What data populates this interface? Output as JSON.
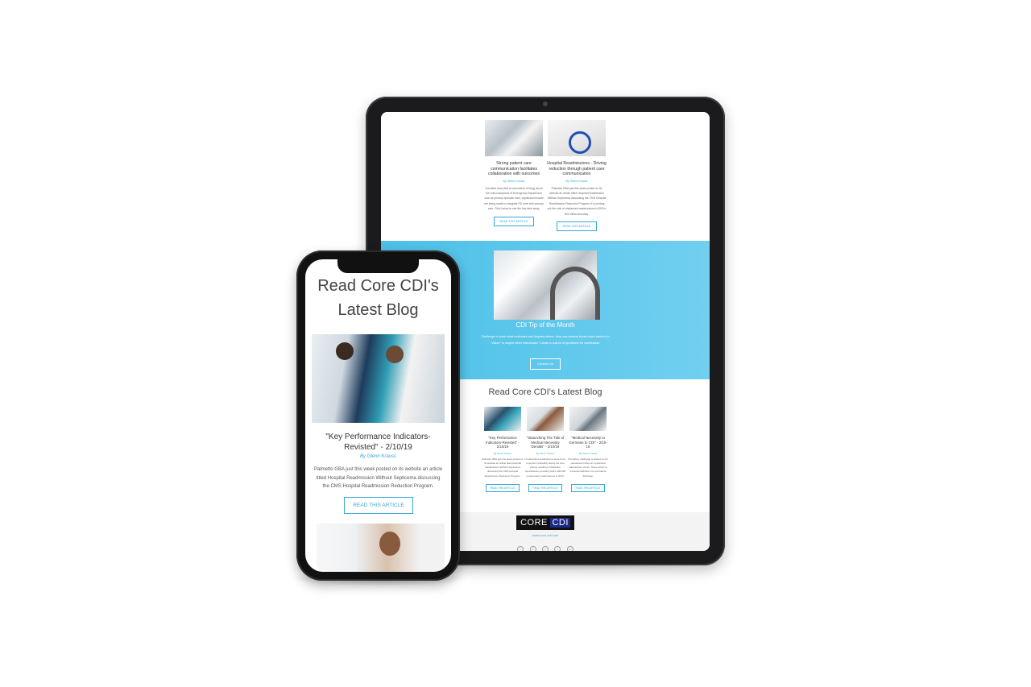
{
  "tablet": {
    "top_articles": [
      {
        "title": "Strong patient care communication facilitates collaboration with outcomes",
        "byline": "By Glenn Krauss",
        "body": "Excellent read (link at conclusion of blog) about the misconceptions of Emergency Department care as primary episodic care, significant inroads are being made to integrate ED care with primary care. Click below to see the key take away.",
        "button": "READ THIS ARTICLE",
        "image_icon": "hospital-image"
      },
      {
        "title": "Hospital Readmissions - Driving reduction through patient care communication",
        "byline": "By Glenn Krauss",
        "body": "Palmetto GBA just this week posted on its website an article titled Hospital Readmission Without Septicema discussing the CMS Hospital Readmission Reduction Program. It's pointing out the cost of unplanned readmissions is $15 to $20 billion annually.",
        "button": "READ THIS ARTICLE",
        "image_icon": "stethoscope-image"
      }
    ],
    "tip": {
      "title": "CDI Tip of the Month",
      "text": "Challenge to learn what motivates and inspires others. How can leaders break down barriers in \"Vision\" to inspire other individuals? Create a culture of questions for clarification.",
      "button": "Contact Us"
    },
    "blog": {
      "title": "Read Core CDI's Latest Blog",
      "articles": [
        {
          "title": "\"Key Performance Indicators-Revisted\" - 2/10/19",
          "byline": "By Glenn Krauss",
          "body": "Palmetto GBA just this week posted on its website an article titled Hospital Readmission Without Septicema discussing the CMS Hospital Readmission Reduction Program.",
          "button": "READ THIS ARTICLE"
        },
        {
          "title": "\"Staunching The Tide of Medical Necessity Denials\" - 2/10/19",
          "byline": "By Glenn Krauss",
          "body": "Unwarranted readmissions were hit by a percent noticeably during the time period, resulting in Medicare beneficiaries providing total's 100,000 unnecessary readmissions in 2013.",
          "button": "READ THIS ARTICLE"
        },
        {
          "title": "\"Medical Necessity to Germane to CDI\" - 2/10-19",
          "byline": "By Glenn Krauss",
          "body": "Premature discharge is always a root cause/event when an unplanned readmission occurs. There exists no universal definition of a premature discharge.",
          "button": "READ THIS ARTICLE"
        }
      ]
    },
    "footer": {
      "logo_core": "CORE",
      "logo_cdi": "CDI",
      "url": "www.core-cdi.com",
      "social": [
        "f",
        "t",
        "y",
        "i",
        "in"
      ]
    }
  },
  "phone": {
    "heading": "Read Core CDI's Latest Blog",
    "article": {
      "title": "\"Key Performance Indicators-Revisted\" - 2/10/19",
      "byline_prefix": "By",
      "byline_name": "Glenn Krauss",
      "body": "Palmetto GBA just this week posted on its website an article titled Hospital Readmission Without Septicema discussing the CMS Hospital Readmission Reduction Program.",
      "button": "READ THIS ARTICLE"
    }
  },
  "colors": {
    "accent": "#35a7d9",
    "band": "#5ec8ec",
    "device": "#1b1b1d"
  }
}
